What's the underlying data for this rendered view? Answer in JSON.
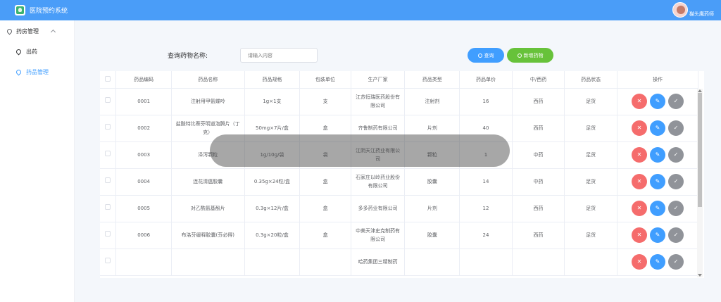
{
  "app": {
    "title": "医院预约系统"
  },
  "user": {
    "name": "猫头鹰药师"
  },
  "sidebar": {
    "group_label": "药房管理",
    "items": [
      {
        "label": "出药",
        "active": false
      },
      {
        "label": "药品管理",
        "active": true
      }
    ]
  },
  "search": {
    "label": "查询药物名称:",
    "placeholder": "请输入内容",
    "query_button": "查询",
    "add_button": "新增药物"
  },
  "table": {
    "columns": [
      "药品编码",
      "药品名称",
      "药品规格",
      "包装单位",
      "生产厂家",
      "药品类型",
      "药品单价",
      "中/西药",
      "药品状态",
      "操作"
    ],
    "rows": [
      {
        "code": "0001",
        "name": "注射用甲氨蝶呤",
        "spec": "1g×1支",
        "unit": "支",
        "maker": "江苏恒瑞医药股份有限公司",
        "type": "注射剂",
        "price": "16",
        "category": "西药",
        "status": "足货"
      },
      {
        "code": "0002",
        "name": "盐酸特比萘芬明道泡腾片（丁克）",
        "spec": "50mg×7片/盒",
        "unit": "盒",
        "maker": "齐鲁制药有限公司",
        "type": "片剂",
        "price": "40",
        "category": "西药",
        "status": "足货"
      },
      {
        "code": "0003",
        "name": "泽泻颗粒",
        "spec": "1g/10g/袋",
        "unit": "袋",
        "maker": "江阴天江药业有限公司",
        "type": "颗粒",
        "price": "1",
        "category": "中药",
        "status": "足货"
      },
      {
        "code": "0004",
        "name": "连花清瘟胶囊",
        "spec": "0.35g×24粒/盒",
        "unit": "盒",
        "maker": "石家庄以岭药业股份有限公司",
        "type": "胶囊",
        "price": "14",
        "category": "中药",
        "status": "足货"
      },
      {
        "code": "0005",
        "name": "对乙酰氨基酚片",
        "spec": "0.3g×12片/盒",
        "unit": "盒",
        "maker": "多多药业有限公司",
        "type": "片剂",
        "price": "12",
        "category": "西药",
        "status": "足货"
      },
      {
        "code": "0006",
        "name": "布洛芬缓释胶囊(芬必得)",
        "spec": "0.3g×20粒/盒",
        "unit": "盒",
        "maker": "中美天津史克制药有限公司",
        "type": "胶囊",
        "price": "24",
        "category": "西药",
        "status": "足货"
      },
      {
        "code": "",
        "name": "",
        "spec": "",
        "unit": "",
        "maker": "哈药集团三精制药",
        "type": "",
        "price": "",
        "category": "",
        "status": ""
      }
    ]
  },
  "icons": {
    "delete": "trash-icon",
    "edit": "pencil-icon",
    "status": "check-circle-icon",
    "query": "search-icon",
    "add": "plus-circle-icon"
  },
  "colors": {
    "header": "#4a9df8",
    "primary": "#409eff",
    "success": "#67c23a",
    "danger": "#f56c6c",
    "info": "#909399"
  }
}
